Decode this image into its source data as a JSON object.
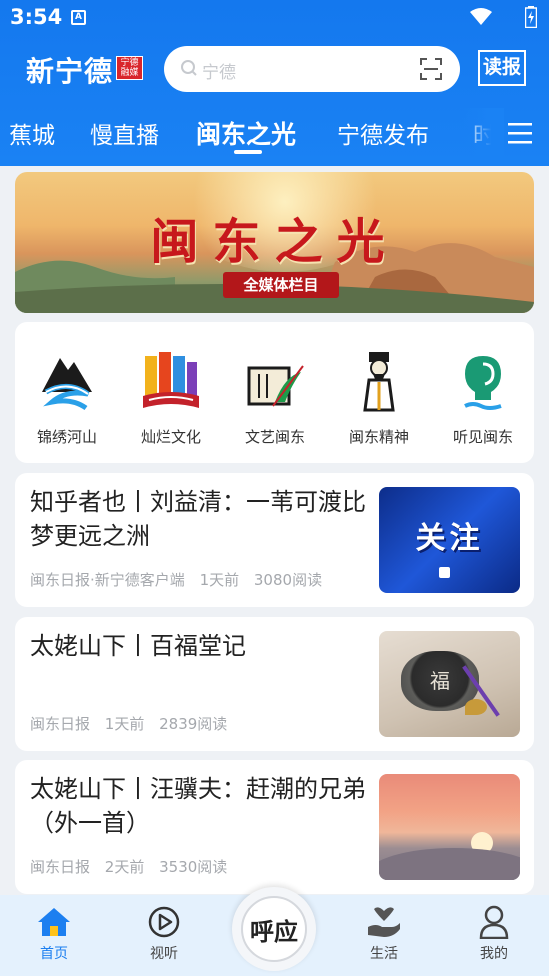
{
  "status": {
    "time": "3:54",
    "notif_glyph": "A"
  },
  "header": {
    "logo": "新宁德",
    "logo_seal": "宁德融媒",
    "search_placeholder": "宁德",
    "read_button": "读报"
  },
  "tabs": [
    {
      "label": "蕉城"
    },
    {
      "label": "慢直播"
    },
    {
      "label": "闽东之光",
      "active": true
    },
    {
      "label": "宁德发布"
    },
    {
      "label": "时"
    }
  ],
  "banner": {
    "title": "闽东之光",
    "tag": "全媒体栏目"
  },
  "categories": [
    {
      "label": "锦绣河山",
      "icon": "mountain-river-icon"
    },
    {
      "label": "灿烂文化",
      "icon": "culture-book-icon"
    },
    {
      "label": "文艺闽东",
      "icon": "art-scroll-icon"
    },
    {
      "label": "闽东精神",
      "icon": "scholar-figure-icon"
    },
    {
      "label": "听见闽东",
      "icon": "ear-wave-icon"
    }
  ],
  "articles": [
    {
      "title": "知乎者也丨刘益清：一苇可渡比梦更远之洲",
      "source": "闽东日报·新宁德客户端",
      "time": "1天前",
      "reads": "3080阅读",
      "thumb_text": "关注"
    },
    {
      "title": "太姥山下丨百福堂记",
      "source": "闽东日报",
      "time": "1天前",
      "reads": "2839阅读",
      "thumb_text": "福"
    },
    {
      "title": "太姥山下丨汪骥夫：赶潮的兄弟（外一首）",
      "source": "闽东日报",
      "time": "2天前",
      "reads": "3530阅读",
      "thumb_text": ""
    }
  ],
  "bottom_nav": [
    {
      "label": "首页",
      "icon": "home-icon",
      "active": true
    },
    {
      "label": "视听",
      "icon": "play-circle-icon"
    },
    {
      "label": "呼应",
      "icon": "center-hu-ying-icon"
    },
    {
      "label": "生活",
      "icon": "hand-heart-icon"
    },
    {
      "label": "我的",
      "icon": "user-icon"
    }
  ],
  "colors": {
    "brand_blue": "#1a82f4",
    "banner_red": "#c7181c",
    "nav_active": "#1c7ff0"
  }
}
